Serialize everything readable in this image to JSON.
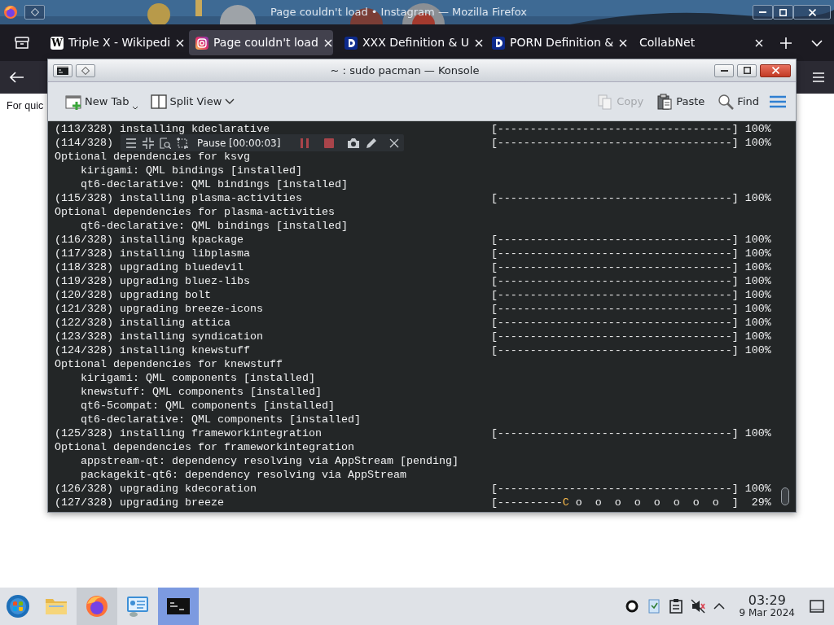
{
  "firefox": {
    "title": "Page couldn't load • Instagram — Mozilla Firefox",
    "tabs": [
      {
        "label": "Triple X - Wikipedi",
        "selected": false,
        "kind": "letter",
        "favicon": "W"
      },
      {
        "label": "Page couldn't load",
        "selected": true,
        "kind": "gradient"
      },
      {
        "label": "XXX Definition & U",
        "selected": false,
        "kind": "dictionary"
      },
      {
        "label": "PORN Definition &",
        "selected": false,
        "kind": "dictionary"
      },
      {
        "label": "CollabNet",
        "selected": false,
        "kind": "plain"
      }
    ],
    "page_text": "For quic"
  },
  "konsole": {
    "title": "~ : sudo pacman — Konsole",
    "toolbar_left": [
      {
        "label": "New Tab",
        "disabled": false,
        "kind": "new-tab"
      },
      {
        "label": "Split View",
        "disabled": false,
        "kind": "split-view"
      }
    ],
    "toolbar_right": [
      {
        "label": "Copy",
        "disabled": true,
        "kind": "copy"
      },
      {
        "label": "Paste",
        "disabled": false,
        "kind": "paste"
      },
      {
        "label": "Find",
        "disabled": false,
        "kind": "find"
      }
    ],
    "lines": [
      {
        "kind": "progress",
        "text": "(113/328) installing kdeclarative",
        "bar": "[------------------------------------]",
        "percent": "100%"
      },
      {
        "kind": "progress",
        "text": "(114/328)",
        "bar": "[------------------------------------]",
        "percent": "100%"
      },
      {
        "kind": "heading",
        "text": "Optional dependencies for ksvg"
      },
      {
        "kind": "dependency",
        "text": "kirigami: QML bindings [installed]"
      },
      {
        "kind": "dependency",
        "text": "qt6-declarative: QML bindings [installed]"
      },
      {
        "kind": "progress",
        "text": "(115/328) installing plasma-activities",
        "bar": "[------------------------------------]",
        "percent": "100%"
      },
      {
        "kind": "heading",
        "text": "Optional dependencies for plasma-activities"
      },
      {
        "kind": "dependency",
        "text": "qt6-declarative: QML bindings [installed]"
      },
      {
        "kind": "progress",
        "text": "(116/328) installing kpackage",
        "bar": "[------------------------------------]",
        "percent": "100%"
      },
      {
        "kind": "progress",
        "text": "(117/328) installing libplasma",
        "bar": "[------------------------------------]",
        "percent": "100%"
      },
      {
        "kind": "progress",
        "text": "(118/328) upgrading bluedevil",
        "bar": "[------------------------------------]",
        "percent": "100%"
      },
      {
        "kind": "progress",
        "text": "(119/328) upgrading bluez-libs",
        "bar": "[------------------------------------]",
        "percent": "100%"
      },
      {
        "kind": "progress",
        "text": "(120/328) upgrading bolt",
        "bar": "[------------------------------------]",
        "percent": "100%"
      },
      {
        "kind": "progress",
        "text": "(121/328) upgrading breeze-icons",
        "bar": "[------------------------------------]",
        "percent": "100%"
      },
      {
        "kind": "progress",
        "text": "(122/328) installing attica",
        "bar": "[------------------------------------]",
        "percent": "100%"
      },
      {
        "kind": "progress",
        "text": "(123/328) installing syndication",
        "bar": "[------------------------------------]",
        "percent": "100%"
      },
      {
        "kind": "progress",
        "text": "(124/328) installing knewstuff",
        "bar": "[------------------------------------]",
        "percent": "100%"
      },
      {
        "kind": "heading",
        "text": "Optional dependencies for knewstuff"
      },
      {
        "kind": "dependency",
        "text": "kirigami: QML components [installed]"
      },
      {
        "kind": "dependency",
        "text": "knewstuff: QML components [installed]"
      },
      {
        "kind": "dependency",
        "text": "qt6-5compat: QML components [installed]"
      },
      {
        "kind": "dependency",
        "text": "qt6-declarative: QML components [installed]"
      },
      {
        "kind": "progress",
        "text": "(125/328) installing frameworkintegration",
        "bar": "[------------------------------------]",
        "percent": "100%"
      },
      {
        "kind": "heading",
        "text": "Optional dependencies for frameworkintegration"
      },
      {
        "kind": "dependency",
        "text": "appstream-qt: dependency resolving via AppStream [pending]"
      },
      {
        "kind": "dependency",
        "text": "packagekit-qt6: dependency resolving via AppStream"
      },
      {
        "kind": "progress",
        "text": "(126/328) upgrading kdecoration",
        "bar": "[------------------------------------]",
        "percent": "100%"
      },
      {
        "kind": "progress",
        "text": "(127/328) upgrading breeze",
        "bar": "[----------",
        "marker": "C",
        "bar_rest": " o  o  o  o  o  o  o  o  ]",
        "percent": "29%"
      }
    ]
  },
  "recorder": {
    "status": "Pause [00:00:03]"
  },
  "taskbar": {
    "apps": [
      {
        "kind": "start",
        "running": false,
        "selected": false
      },
      {
        "kind": "folder",
        "running": false,
        "selected": false
      },
      {
        "kind": "browser",
        "running": true,
        "selected": false
      },
      {
        "kind": "monitor",
        "running": false,
        "selected": false
      },
      {
        "kind": "terminal",
        "selected": true
      }
    ],
    "clock": {
      "time": "03:29",
      "date": "9 Mar 2024"
    }
  }
}
